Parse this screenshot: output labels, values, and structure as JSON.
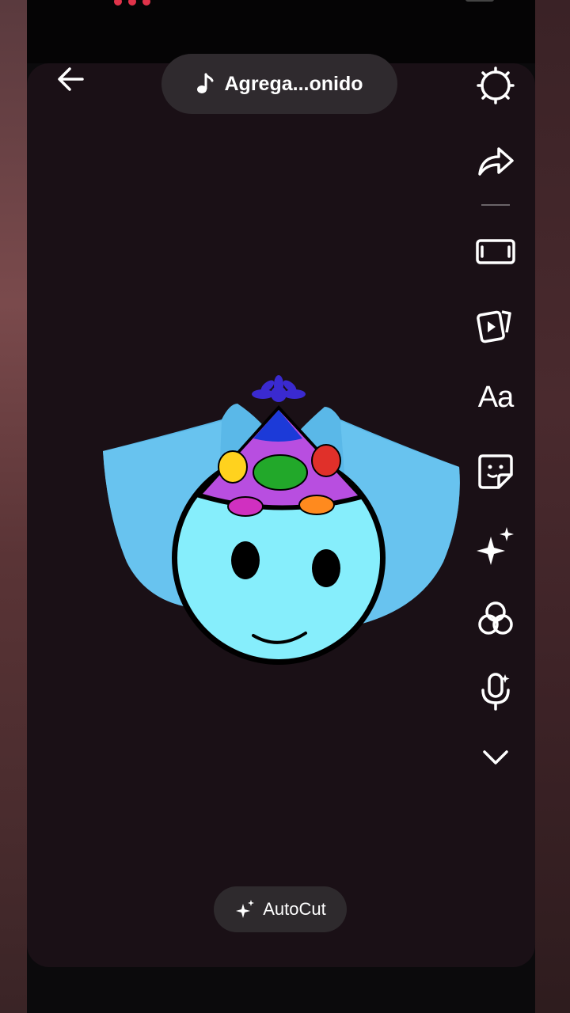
{
  "header": {
    "back_icon": "arrow-left-icon",
    "sound_label": "Agrega...onido",
    "sound_icon": "music-note-icon"
  },
  "toolbar": {
    "items": [
      {
        "name": "settings",
        "icon": "gear-icon"
      },
      {
        "name": "share",
        "icon": "share-arrow-icon"
      },
      {
        "name": "aspect",
        "icon": "aspect-ratio-icon"
      },
      {
        "name": "templates",
        "icon": "video-cards-icon"
      },
      {
        "name": "text",
        "icon": "text-icon",
        "label": "Aa"
      },
      {
        "name": "stickers",
        "icon": "sticker-icon"
      },
      {
        "name": "effects",
        "icon": "sparkles-icon"
      },
      {
        "name": "filters",
        "icon": "filters-icon"
      },
      {
        "name": "voice",
        "icon": "microphone-icon"
      },
      {
        "name": "more",
        "icon": "chevron-down-icon"
      }
    ]
  },
  "bottom": {
    "autocut_label": "AutoCut",
    "autocut_icon": "sparkles-icon"
  },
  "colors": {
    "canvas_bg": "#1a1016",
    "pill_bg": "#2f2a2e",
    "icon_color": "#ffffff"
  }
}
